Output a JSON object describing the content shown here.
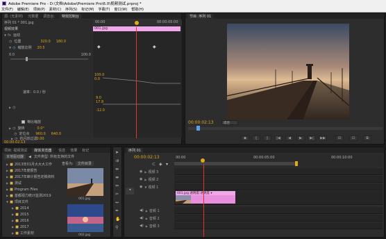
{
  "window": {
    "title": "Adobe Premiere Pro - D:\\文档\\Adobe\\Premiere Pro\\6.0\\视频测试.prproj *"
  },
  "menu": [
    "文件(F)",
    "编辑(E)",
    "项目(P)",
    "素材(C)",
    "序列(S)",
    "标记(M)",
    "字幕(T)",
    "窗口(W)",
    "帮助(H)"
  ],
  "source_panel": {
    "tabs": [
      "源: (无素材)",
      "元数据",
      "调音台:",
      "特效控制台"
    ],
    "header_left": "序列 01 * 001.jpg",
    "header_clip": "001.jpg",
    "ruler_left": "00:00",
    "ruler_right": "00:00:05:00",
    "section_video": "视频效果",
    "motion_label": "运动",
    "position_label": "位置",
    "position_x": "320.0",
    "position_y": "180.0",
    "scale_label": "缩放比例",
    "scale_value": "20.5",
    "scale_min": "0.0",
    "scale_max": "100.0",
    "graph_top": "100.0",
    "graph_bottom": "0.0",
    "velocity_label": "速率：0.0 / 秒",
    "graph2_top": "9.0",
    "graph2_mid": "17.8",
    "graph2_bottom": "-12.0",
    "uniform_label": "等比缩放",
    "rotation_label": "旋转",
    "rotation_value": "0.0°",
    "anchor_label": "定位点",
    "anchor_x": "960.0",
    "anchor_y": "640.0",
    "flicker_label": "抗闪烁过滤",
    "flicker_value": "0.00",
    "timecode": "00:00:02:13"
  },
  "program_panel": {
    "tab": "节目: 序列 01",
    "timecode": "00:00:02:13",
    "fit": "适合",
    "transport": [
      "◆",
      "{",
      "}",
      "|◀",
      "◀",
      "▶",
      "▶|",
      "▶▶",
      "⊟",
      "⊡",
      "⧉"
    ]
  },
  "project_panel": {
    "tabs": [
      "项目: 视频测试",
      "媒体浏览器",
      "信息",
      "效果",
      "标记"
    ],
    "path": "本地驱动器",
    "filter": "文件类型: 所有支持的文件",
    "view_label": "查看为:",
    "view_value": "文件目录",
    "tree": [
      "2013年01月大大大工作",
      "2017年度报告",
      "2017年审计报告定稿资料",
      "测试",
      "Program Files",
      "首都视力统计监测2019",
      "项目文件",
      "2014",
      "2015",
      "2016",
      "2017",
      "工作素材"
    ],
    "thumbs": [
      "001.jpg",
      "002.jpg"
    ]
  },
  "timeline_panel": {
    "tab": "序列 01",
    "timecode": "00:00:02:13",
    "ruler": [
      "00:00",
      "00:00:05:00",
      "00:00:10:00"
    ],
    "video_tracks": [
      "视频 3",
      "视频 2",
      "视频 1"
    ],
    "audio_tracks": [
      "音频 1",
      "音频 2",
      "音频 3"
    ],
    "clip_label": "001.jpg  透明度:透明度 ▾",
    "clip_short": "001.jpg"
  },
  "colors": {
    "accent_pink": "#f0a8e8",
    "playhead": "#e0342c",
    "timecode": "#e0a81c"
  }
}
